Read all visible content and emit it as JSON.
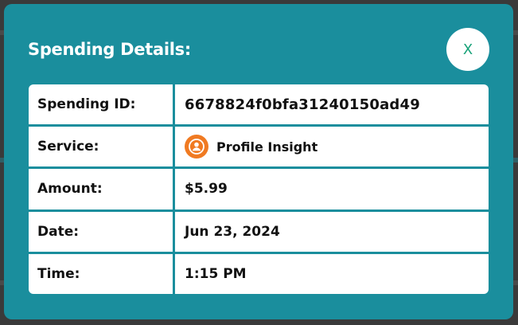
{
  "modal": {
    "title": "Spending Details:",
    "close_label": "X"
  },
  "details": {
    "rows": [
      {
        "label": "Spending ID:",
        "value": "6678824f0bfa31240150ad49"
      },
      {
        "label": "Service:",
        "value": "Profile Insight",
        "icon": "user-circle-icon"
      },
      {
        "label": "Amount:",
        "value": "$5.99"
      },
      {
        "label": "Date:",
        "value": "Jun 23, 2024"
      },
      {
        "label": "Time:",
        "value": "1:15 PM"
      }
    ]
  },
  "colors": {
    "modal_bg": "#1a8e9d",
    "close_text": "#1aa37a",
    "service_icon_bg": "#f07a22",
    "backdrop": "#3a3a3a"
  }
}
